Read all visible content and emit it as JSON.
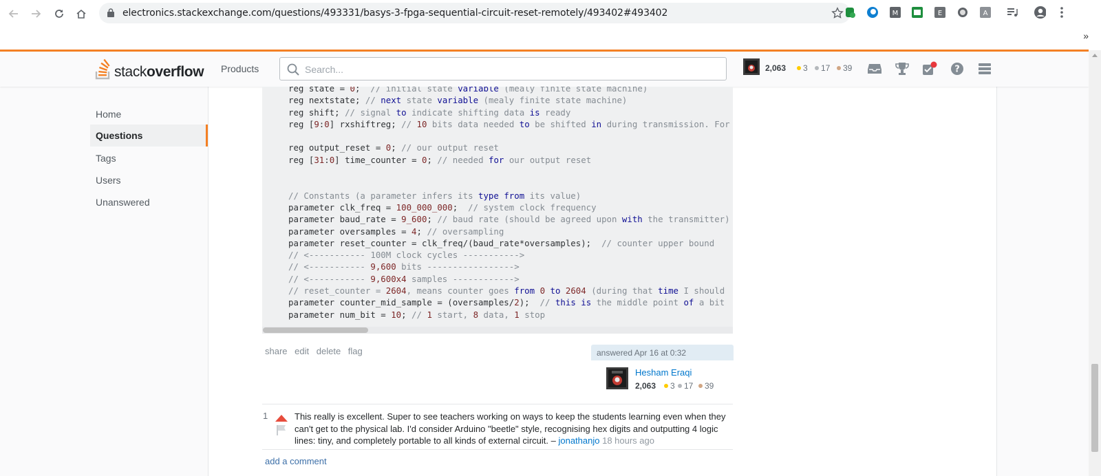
{
  "browser": {
    "url": "electronics.stackexchange.com/questions/493331/basys-3-fpga-sequential-circuit-reset-remotely/493402#493402",
    "bookmarks_overflow": "»"
  },
  "site": {
    "logo_light": "stack",
    "logo_bold": "overflow",
    "products": "Products",
    "search_placeholder": "Search...",
    "user": {
      "reputation": "2,063",
      "gold": "3",
      "silver": "17",
      "bronze": "39"
    },
    "colors": {
      "accent": "#f48024",
      "link": "#0077cc",
      "upvote": "#e74c3c"
    }
  },
  "leftnav": {
    "items": [
      {
        "label": "Home"
      },
      {
        "label": "Questions",
        "active": true
      },
      {
        "label": "Tags"
      },
      {
        "label": "Users"
      },
      {
        "label": "Unanswered"
      }
    ]
  },
  "code": {
    "lines": [
      "reg state = 0;  // initial state variable (mealy finite state machine)",
      "reg nextstate; // next state variable (mealy finite state machine)",
      "reg shift; // signal to indicate shifting data is ready",
      "reg [9:0] rxshiftreg; // 10 bits data needed to be shifted in during transmission. For",
      "",
      "reg output_reset = 0; // our output reset",
      "reg [31:0] time_counter = 0; // needed for our output reset",
      "",
      "",
      "// Constants (a parameter infers its type from its value)",
      "parameter clk_freq = 100_000_000;  // system clock frequency",
      "parameter baud_rate = 9_600; // baud rate (should be agreed upon with the transmitter)",
      "parameter oversamples = 4; // oversampling",
      "parameter reset_counter = clk_freq/(baud_rate*oversamples);  // counter upper bound",
      "// <----------- 100M clock cycles ----------->",
      "// <----------- 9,600 bits ----------------->",
      "// <----------- 9,600x4 samples ------------>",
      "// reset_counter = 2604, means counter goes from 0 to 2604 (during that time I should",
      "parameter counter_mid_sample = (oversamples/2);  // this is the middle point of a bit",
      "parameter num_bit = 10; // 1 start, 8 data, 1 stop"
    ]
  },
  "post_menu": [
    "share",
    "edit",
    "delete",
    "flag"
  ],
  "signature": {
    "time": "answered Apr 16 at 0:32",
    "name": "Hesham Eraqi",
    "reputation": "2,063",
    "gold": "3",
    "silver": "17",
    "bronze": "39"
  },
  "comments": [
    {
      "score": "1",
      "text": "This really is excellent. Super to see teachers working on ways to keep the students learning even when they can't get to the physical lab. I'd consider Arduino \"beetle\" style, recognising hex digits and outputting 4 logic lines: tiny, and completely portable to all kinds of external circuit. –",
      "user": "jonathanjo",
      "time": "18 hours ago"
    }
  ],
  "add_comment": "add a comment"
}
